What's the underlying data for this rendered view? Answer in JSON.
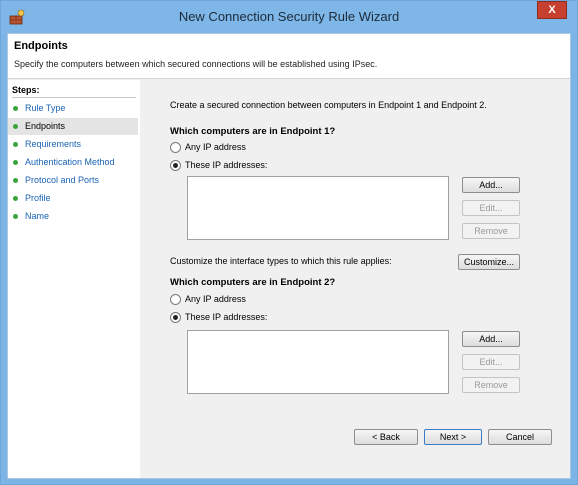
{
  "window": {
    "title": "New Connection Security Rule Wizard",
    "close_glyph": "X",
    "app_icon": "firewall-wizard-icon",
    "accent_color": "#7eb6e8"
  },
  "header": {
    "title": "Endpoints",
    "subtitle": "Specify the computers between which secured connections will be established using IPsec."
  },
  "steps": {
    "heading": "Steps:",
    "items": [
      {
        "label": "Rule Type",
        "active": false
      },
      {
        "label": "Endpoints",
        "active": true
      },
      {
        "label": "Requirements",
        "active": false
      },
      {
        "label": "Authentication Method",
        "active": false
      },
      {
        "label": "Protocol and Ports",
        "active": false
      },
      {
        "label": "Profile",
        "active": false
      },
      {
        "label": "Name",
        "active": false
      }
    ]
  },
  "main": {
    "intro": "Create a secured connection between computers in Endpoint 1 and Endpoint 2.",
    "endpoint1": {
      "question": "Which computers are in Endpoint  1?",
      "option_any": "Any IP address",
      "option_these": "These IP addresses:",
      "selected": "these",
      "buttons": {
        "add": "Add...",
        "edit": "Edit...",
        "remove": "Remove"
      }
    },
    "customize_label": "Customize the interface types to which this rule applies:",
    "customize_button": "Customize...",
    "endpoint2": {
      "question": "Which computers are in Endpoint  2?",
      "option_any": "Any IP address",
      "option_these": "These IP addresses:",
      "selected": "these",
      "buttons": {
        "add": "Add...",
        "edit": "Edit...",
        "remove": "Remove"
      }
    }
  },
  "footer": {
    "back": "< Back",
    "next": "Next >",
    "cancel": "Cancel"
  }
}
